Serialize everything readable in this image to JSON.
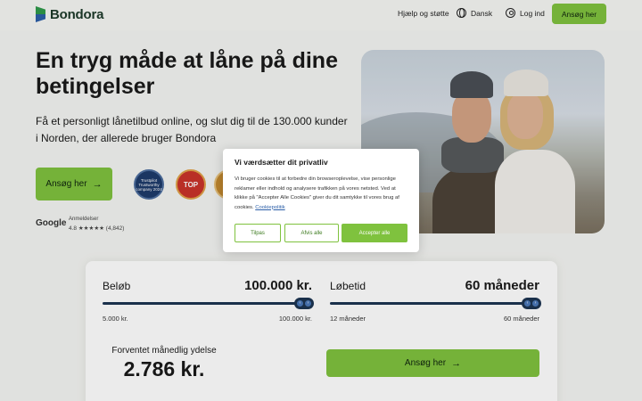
{
  "header": {
    "logo_text": "Bondora",
    "help_link": "Hjælp og støtte",
    "language": "Dansk",
    "login": "Log ind",
    "cta": "Ansøg her"
  },
  "hero": {
    "title": "En tryg måde at låne på dine betingelser",
    "subtitle": "Få et personligt lånetilbud online, og slut dig til de 130.000 kunder i Norden, der allerede bruger Bondora",
    "cta": "Ansøg her",
    "cta_arrow": "→",
    "badges": {
      "trust": "Trustpilot Trustworthy company 2024",
      "top": "TOP"
    },
    "reviews": {
      "brand": "Google",
      "label": "Anmeldelser",
      "rating": "4.8 ★★★★★ (4,842)"
    }
  },
  "calculator": {
    "amount_label": "Beløb",
    "amount_value": "100.000 kr.",
    "amount_min": "5.000 kr.",
    "amount_max": "100.000 kr.",
    "term_label": "Løbetid",
    "term_value": "60 måneder",
    "term_min": "12 måneder",
    "term_max": "60 måneder",
    "monthly_label": "Forventet månedlig ydelse",
    "monthly_value": "2.786 kr.",
    "cta": "Ansøg her",
    "cta_arrow": "→"
  },
  "cookie": {
    "title": "Vi værdsætter dit privatliv",
    "text": "Vi bruger cookies til at forbedre din browseroplevelse, vise personlige reklamer eller indhold og analysere trafikken på vores netsted. Ved at klikke på \"Accepter Alle Cookies\" giver du dit samtykke til vores brug af cookies.",
    "link": "Cookiepolitik",
    "btn_customize": "Tilpas",
    "btn_reject": "Afvis alle",
    "btn_accept": "Accepter alle"
  },
  "colors": {
    "accent": "#7fc23e",
    "slider": "#1d3552",
    "link": "#2c5fa8"
  }
}
